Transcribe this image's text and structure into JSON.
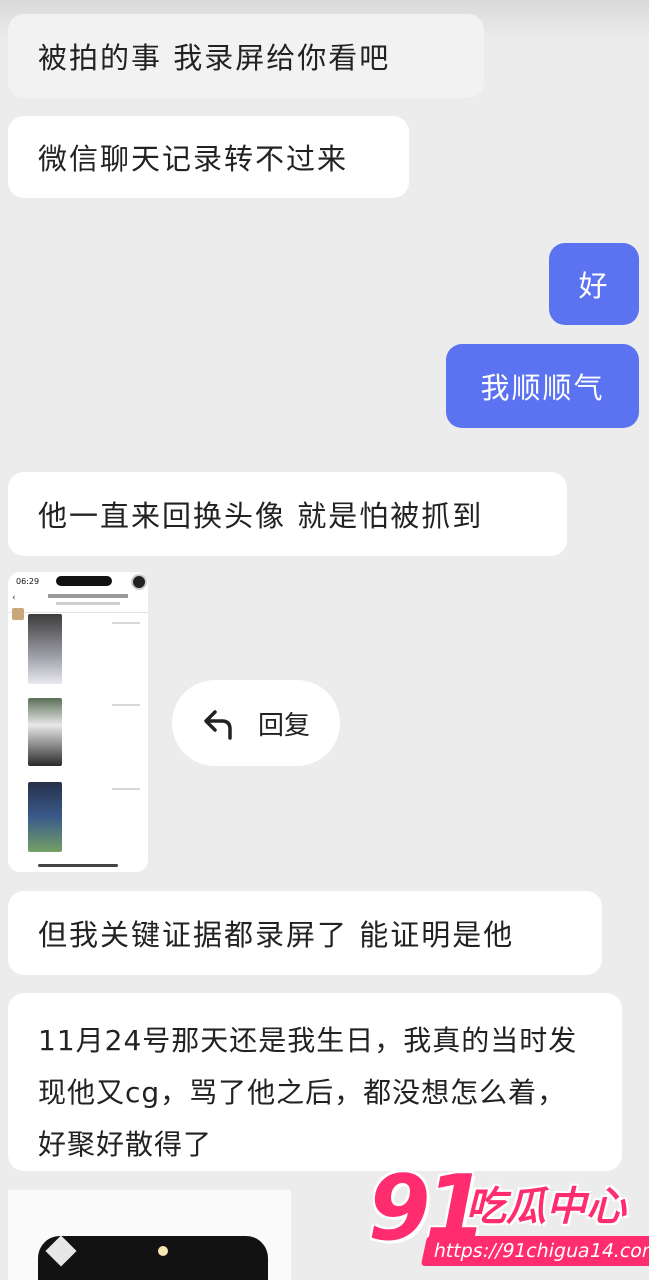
{
  "messages": [
    {
      "text": "被拍的事  我录屏给你看吧"
    },
    {
      "text": "微信聊天记录转不过来"
    },
    {
      "text": "好"
    },
    {
      "text": "我顺顺气"
    },
    {
      "text": "他一直来回换头像  就是怕被抓到"
    },
    {
      "text": "但我关键证据都录屏了  能证明是他"
    },
    {
      "text": "11月24号那天还是我生日，我真的当时发现他又cg，骂了他之后，都没想怎么着，好聚好散得了"
    }
  ],
  "video": {
    "status_time": "06:29"
  },
  "reply": {
    "label": "回复"
  },
  "watermark": {
    "number": "91",
    "name": "吃瓜中心",
    "url": "https://91chigua14.com"
  },
  "colors": {
    "outgoing": "#5b73f0",
    "incoming": "#ffffff",
    "background": "#ececec",
    "watermark": "#ff2d6f"
  },
  "icons": {
    "reply": "reply-arrow-icon",
    "play": "play-icon"
  }
}
